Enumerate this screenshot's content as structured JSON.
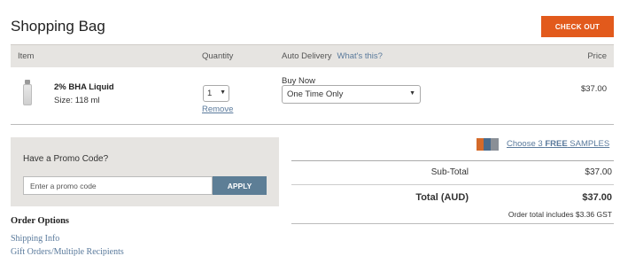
{
  "header": {
    "title": "Shopping Bag",
    "checkout_label": "CHECK OUT",
    "checkout_color": "#e25a1c"
  },
  "table": {
    "columns": {
      "item": "Item",
      "quantity": "Quantity",
      "auto_delivery": "Auto Delivery",
      "whats_this": "What's this?",
      "price": "Price"
    }
  },
  "product": {
    "name": "2% BHA Liquid",
    "size": "Size: 118 ml",
    "quantity": "1",
    "remove_label": "Remove",
    "buy_label": "Buy Now",
    "delivery_option": "One Time Only",
    "price": "$37.00",
    "thumbnail_icon": "product-bottle-icon"
  },
  "promo": {
    "title": "Have a Promo Code?",
    "placeholder": "Enter a promo code",
    "apply_label": "APPLY",
    "apply_color": "#5d7e96"
  },
  "order_options": {
    "heading": "Order Options",
    "links": [
      "Shipping Info",
      "Gift Orders/Multiple Recipients"
    ]
  },
  "samples": {
    "prefix": "Choose 3 ",
    "bold": "FREE",
    "suffix": " SAMPLES",
    "icon": "samples-books-icon"
  },
  "totals": {
    "subtotal_label": "Sub-Total",
    "subtotal_value": "$37.00",
    "total_label": "Total (AUD)",
    "total_value": "$37.00",
    "gst_note": "Order total includes $3.36 GST"
  },
  "colors": {
    "link": "#5a7a9c",
    "header_bg": "#e6e4e1"
  }
}
